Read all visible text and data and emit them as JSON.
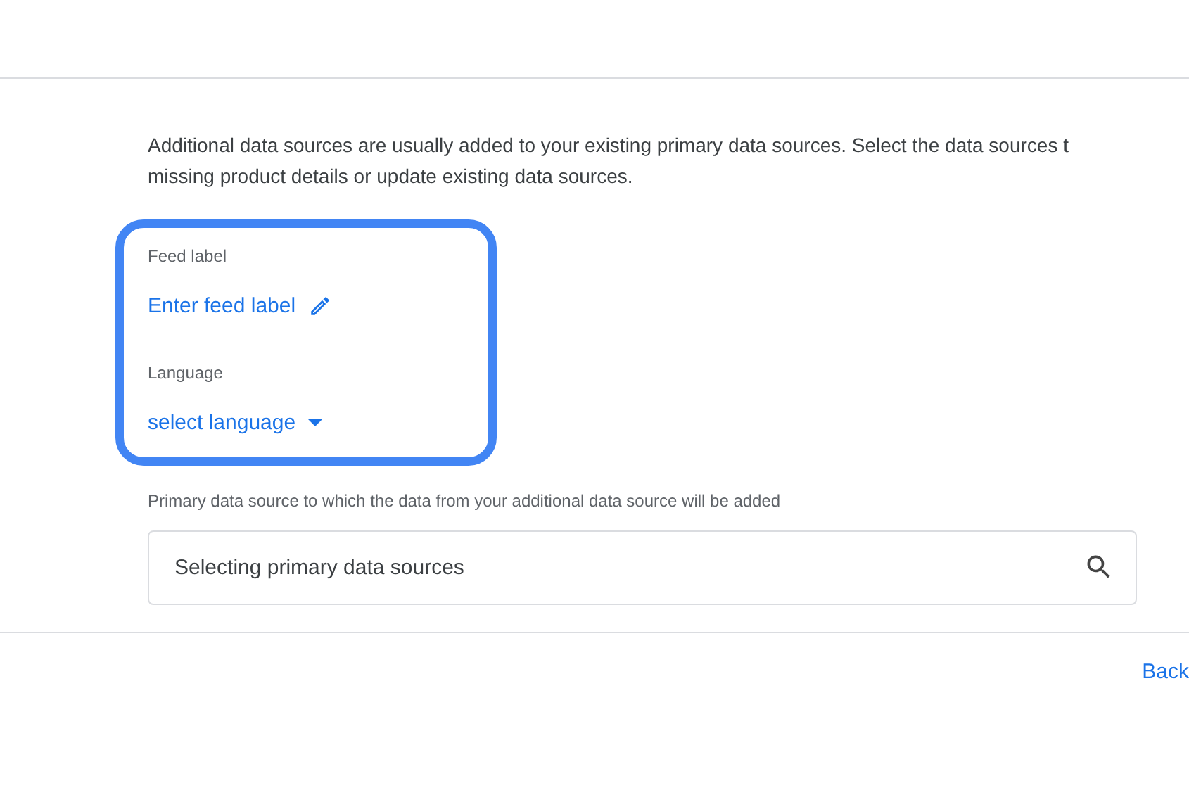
{
  "description": "Additional data sources are usually added to your existing primary data sources. Select the data sources t\nmissing product details or update existing data sources.",
  "feed_label": {
    "label": "Feed label",
    "value": "Enter feed label"
  },
  "language": {
    "label": "Language",
    "value": "select language"
  },
  "primary_source": {
    "label": "Primary data source to which the data from your additional data source will be added",
    "placeholder": "Selecting primary data sources"
  },
  "footer": {
    "back": "Back"
  }
}
